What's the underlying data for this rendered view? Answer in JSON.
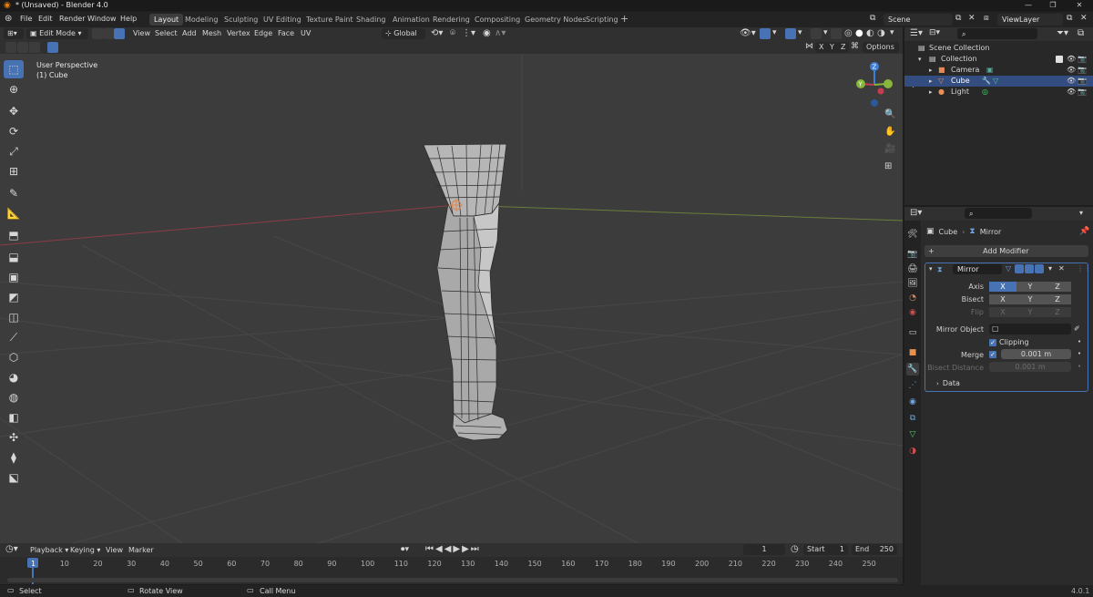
{
  "window": {
    "title": "* (Unsaved) - Blender 4.0"
  },
  "menus": [
    "File",
    "Edit",
    "Render",
    "Window",
    "Help"
  ],
  "workspaces": [
    {
      "label": "Layout",
      "active": true
    },
    {
      "label": "Modeling"
    },
    {
      "label": "Sculpting"
    },
    {
      "label": "UV Editing"
    },
    {
      "label": "Texture Paint"
    },
    {
      "label": "Shading"
    },
    {
      "label": "Animation"
    },
    {
      "label": "Rendering"
    },
    {
      "label": "Compositing"
    },
    {
      "label": "Geometry Nodes"
    },
    {
      "label": "Scripting"
    }
  ],
  "add_workspace": "+",
  "scene": {
    "scene_label": "Scene",
    "view_layer_label": "ViewLayer"
  },
  "viewport": {
    "mode": "Edit Mode",
    "menus": [
      "View",
      "Select",
      "Add",
      "Mesh",
      "Vertex",
      "Edge",
      "Face",
      "UV"
    ],
    "transform": "Global",
    "axis_labels": [
      "X",
      "Y",
      "Z"
    ],
    "options_label": "Options",
    "overlay_text": {
      "perspective": "User Perspective",
      "object": "(1) Cube"
    },
    "gizmo_axes": {
      "x": "X",
      "y": "Y",
      "z": "Z"
    }
  },
  "outliner": {
    "search_placeholder": "",
    "rows": [
      {
        "label": "Scene Collection",
        "indent": 0
      },
      {
        "label": "Collection",
        "indent": 1
      },
      {
        "label": "Camera",
        "indent": 2
      },
      {
        "label": "Cube",
        "indent": 2,
        "selected": true
      },
      {
        "label": "Light",
        "indent": 2
      }
    ]
  },
  "properties": {
    "breadcrumb": {
      "object": "Cube",
      "modifier": "Mirror"
    },
    "add_modifier": "Add Modifier",
    "modifier": {
      "name": "Mirror",
      "axis_label": "Axis",
      "bisect_label": "Bisect",
      "flip_label": "Flip",
      "axes": [
        "X",
        "Y",
        "Z"
      ],
      "axis_enabled": [
        true,
        false,
        false
      ],
      "mirror_object_label": "Mirror Object",
      "clipping_label": "Clipping",
      "clipping": true,
      "merge_label": "Merge",
      "merge_value": "0.001 m",
      "merge": true,
      "bisect_distance_label": "Bisect Distance",
      "bisect_distance_value": "0.001 m",
      "data_label": "Data"
    }
  },
  "timeline": {
    "menus": [
      "Playback",
      "Keying",
      "View",
      "Marker"
    ],
    "current_frame": "1",
    "start_label": "Start",
    "start_value": "1",
    "end_label": "End",
    "end_value": "250",
    "ruler": [
      "1",
      "10",
      "20",
      "30",
      "40",
      "50",
      "60",
      "70",
      "80",
      "90",
      "100",
      "110",
      "120",
      "130",
      "140",
      "150",
      "160",
      "170",
      "180",
      "190",
      "200",
      "210",
      "220",
      "230",
      "240",
      "250"
    ]
  },
  "statusbar": {
    "items": [
      "Select",
      "Rotate View",
      "Call Menu"
    ],
    "version": "4.0.1"
  },
  "colors": {
    "accent": "#4772b3",
    "viewport_bg": "#3c3c3c",
    "panel_bg": "#2b2b2b",
    "x_axis": "#c83c50",
    "y_axis": "#86b63a",
    "z_axis": "#3d7fd8"
  }
}
